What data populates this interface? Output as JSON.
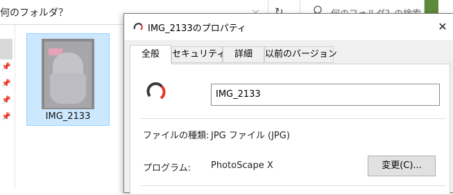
{
  "explorer": {
    "address_text": "何のフォルダ？",
    "search_placeholder": "何のフォルダ？の検索",
    "file": {
      "name": "IMG_2133"
    }
  },
  "dialog": {
    "title": "IMG_2133のプロパティ",
    "tabs": [
      {
        "label": "全般",
        "active": true
      },
      {
        "label": "セキュリティ",
        "active": false
      },
      {
        "label": "詳細",
        "active": false
      },
      {
        "label": "以前のバージョン",
        "active": false
      }
    ],
    "filename_value": "IMG_2133",
    "rows": [
      {
        "label": "ファイルの種類:",
        "value": "JPG ファイル (JPG)"
      },
      {
        "label": "プログラム:",
        "value": "PhotoScape X"
      }
    ],
    "change_button_label": "変更(C)..."
  },
  "colors": {
    "selection_bg": "#cce8ff",
    "selection_border": "#99d1ff",
    "dialog_bg": "#f0f0f0",
    "app_icon_red": "#e2342c"
  }
}
